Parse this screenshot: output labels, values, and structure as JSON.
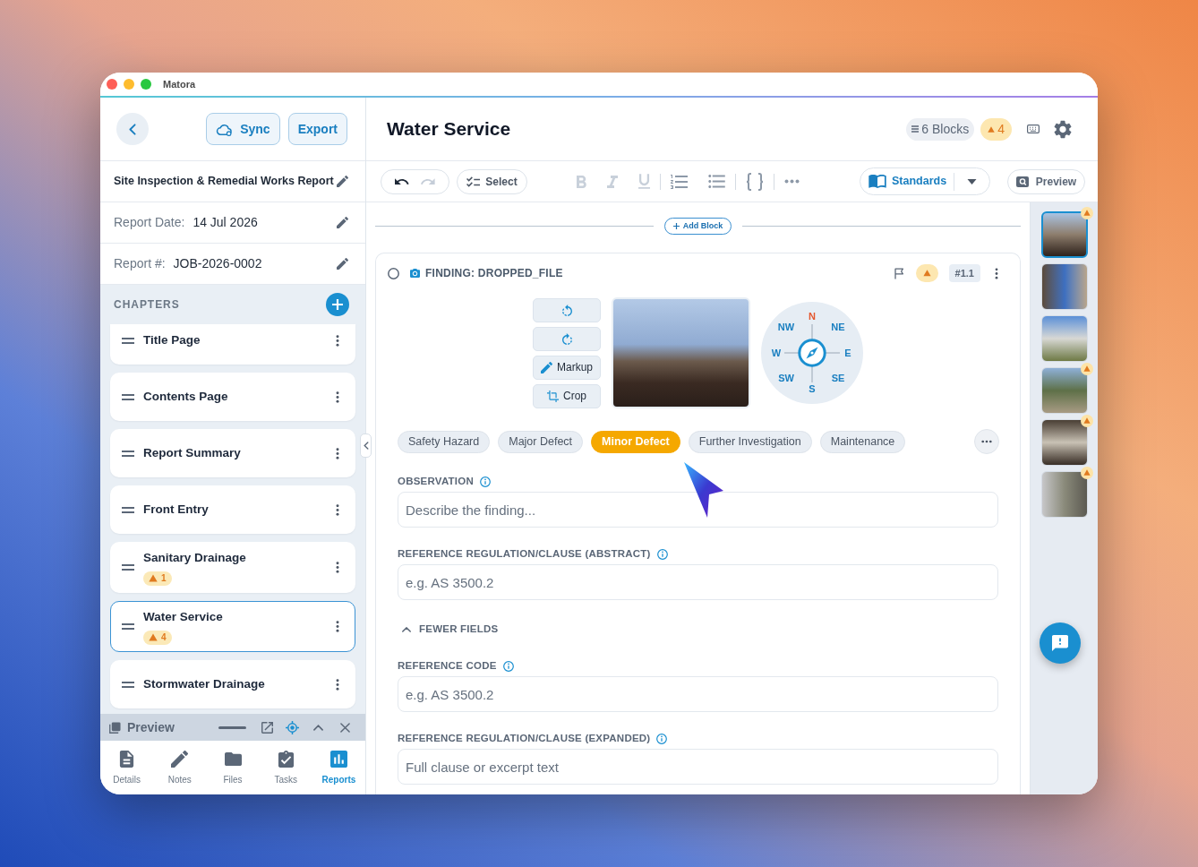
{
  "window": {
    "title": "Matora"
  },
  "sidebar": {
    "header_buttons": [
      {
        "kind": "sync",
        "label": "Sync"
      },
      {
        "kind": "plain",
        "label": "Export"
      }
    ],
    "report_fields": [
      {
        "kind": "title",
        "value": "Site Inspection & Remedial Works Report"
      },
      {
        "kind": "labeled",
        "label": "Report Date:",
        "value": "14 Jul 2026"
      },
      {
        "kind": "labeled",
        "label": "Report #:",
        "value": "JOB-2026-0002"
      }
    ],
    "chapters_heading": "CHAPTERS",
    "chapters": [
      {
        "title": "Title Page",
        "selected": false
      },
      {
        "title": "Contents Page",
        "selected": false
      },
      {
        "title": "Report Summary",
        "selected": false
      },
      {
        "title": "Front Entry",
        "selected": false
      },
      {
        "title": "Sanitary Drainage",
        "selected": false,
        "warnings": "1"
      },
      {
        "title": "Water Service",
        "selected": true,
        "warnings": "4"
      },
      {
        "title": "Stormwater Drainage",
        "selected": false
      }
    ],
    "preview_bar": {
      "label": "Preview"
    },
    "bottom_tabs": [
      {
        "kind": "details",
        "label": "Details",
        "selected": false
      },
      {
        "kind": "notes",
        "label": "Notes",
        "selected": false
      },
      {
        "kind": "files",
        "label": "Files",
        "selected": false
      },
      {
        "kind": "tasks",
        "label": "Tasks",
        "selected": false
      },
      {
        "kind": "reports",
        "label": "Reports",
        "selected": true
      }
    ]
  },
  "editor": {
    "title": "Water Service",
    "blocks_count": "6 Blocks",
    "warnings_count": "4",
    "toolbar": {
      "history": [
        {
          "kind": "undo",
          "disabled": false
        },
        {
          "kind": "redo",
          "disabled": true
        }
      ],
      "select_label": "Select",
      "format_groups": [
        [
          {
            "kind": "bold",
            "disabled": true
          },
          {
            "kind": "italic",
            "disabled": true
          },
          {
            "kind": "underline",
            "disabled": true
          }
        ],
        [
          {
            "kind": "numbered_list",
            "disabled": false
          },
          {
            "kind": "bulleted_list",
            "disabled": false
          }
        ],
        [
          {
            "kind": "code",
            "disabled": false
          }
        ],
        [
          {
            "kind": "more",
            "disabled": false
          }
        ]
      ],
      "standards_label": "Standards",
      "preview_label": "Preview"
    },
    "add_block_label": "Add Block",
    "finding": {
      "checked": false,
      "title": "FINDING: DROPPED_FILE",
      "flagged": false,
      "has_warning": true,
      "number": "#1.1",
      "image_tools": [
        {
          "kind": "rotate_left"
        },
        {
          "kind": "rotate_right"
        },
        {
          "kind": "markup",
          "label": "Markup"
        },
        {
          "kind": "crop",
          "label": "Crop"
        }
      ],
      "compass": {
        "nw": "NW",
        "n": "N",
        "ne": "NE",
        "w": "W",
        "e": "E",
        "sw": "SW",
        "s": "S",
        "se": "SE"
      },
      "tags": [
        {
          "label": "Safety Hazard",
          "selected": false
        },
        {
          "label": "Major Defect",
          "selected": false
        },
        {
          "label": "Minor Defect",
          "selected": true
        },
        {
          "label": "Further Investigation",
          "selected": false
        },
        {
          "label": "Maintenance",
          "selected": false
        }
      ],
      "fields": [
        {
          "label": "OBSERVATION",
          "placeholder": "Describe the finding..."
        },
        {
          "label": "REFERENCE REGULATION/CLAUSE (ABSTRACT)",
          "placeholder": "e.g. AS 3500.2"
        }
      ],
      "fields_toggle": {
        "label": "FEWER FIELDS",
        "expanded": true
      },
      "extra_fields": [
        {
          "label": "REFERENCE CODE",
          "placeholder": "e.g. AS 3500.2"
        },
        {
          "label": "REFERENCE REGULATION/CLAUSE (EXPANDED)",
          "placeholder": "Full clause or excerpt text"
        }
      ]
    }
  },
  "photos": [
    {
      "selected": true,
      "warning": true
    },
    {
      "selected": false,
      "warning": false
    },
    {
      "selected": false,
      "warning": false
    },
    {
      "selected": false,
      "warning": true
    },
    {
      "selected": false,
      "warning": true
    },
    {
      "selected": false,
      "warning": true
    }
  ]
}
